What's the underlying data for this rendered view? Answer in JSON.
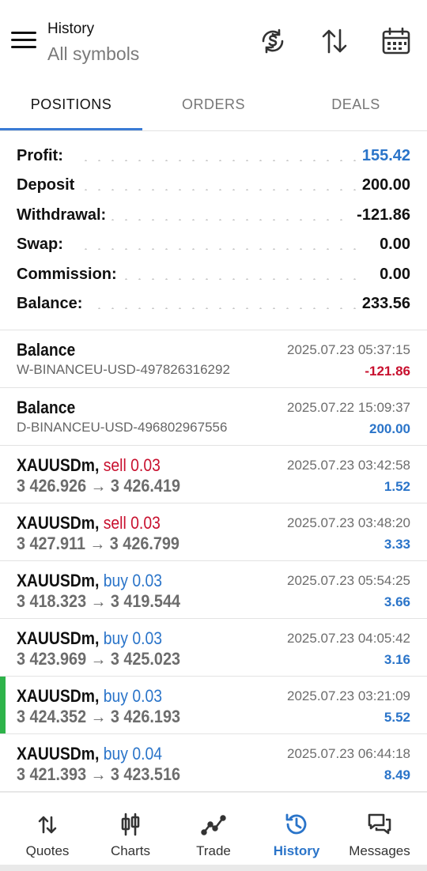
{
  "header": {
    "title": "History",
    "subtitle": "All symbols",
    "icons": [
      "menu-icon",
      "currency-exchange-icon",
      "sort-icon",
      "calendar-icon"
    ]
  },
  "tabs": [
    {
      "label": "POSITIONS",
      "active": true
    },
    {
      "label": "ORDERS",
      "active": false
    },
    {
      "label": "DEALS",
      "active": false
    }
  ],
  "summary": [
    {
      "label": "Profit:",
      "value": "155.42",
      "color": "#2a74c9"
    },
    {
      "label": "Deposit",
      "value": "200.00",
      "color": "#111111"
    },
    {
      "label": "Withdrawal:",
      "value": "-121.86",
      "color": "#111111"
    },
    {
      "label": "Swap:",
      "value": "0.00",
      "color": "#111111"
    },
    {
      "label": "Commission:",
      "value": "0.00",
      "color": "#111111"
    },
    {
      "label": "Balance:",
      "value": "233.56",
      "color": "#111111"
    }
  ],
  "deals": [
    {
      "type": "balance",
      "title": "Balance",
      "detail": "W-BINANCEU-USD-497826316292",
      "time": "2025.07.23 05:37:15",
      "amount": "-121.86",
      "amount_color": "#c8102e"
    },
    {
      "type": "balance",
      "title": "Balance",
      "detail": "D-BINANCEU-USD-496802967556",
      "time": "2025.07.22 15:09:37",
      "amount": "200.00",
      "amount_color": "#2a74c9"
    },
    {
      "type": "trade",
      "symbol": "XAUUSDm,",
      "action": "sell 0.03",
      "action_color": "#c8102e",
      "prices": "3 426.926 → 3 426.419",
      "time": "2025.07.23 03:42:58",
      "amount": "1.52",
      "amount_color": "#2a74c9"
    },
    {
      "type": "trade",
      "symbol": "XAUUSDm,",
      "action": "sell 0.03",
      "action_color": "#c8102e",
      "prices": "3 427.911 → 3 426.799",
      "time": "2025.07.23 03:48:20",
      "amount": "3.33",
      "amount_color": "#2a74c9"
    },
    {
      "type": "trade",
      "symbol": "XAUUSDm,",
      "action": "buy 0.03",
      "action_color": "#2a74c9",
      "prices": "3 418.323 → 3 419.544",
      "time": "2025.07.23 05:54:25",
      "amount": "3.66",
      "amount_color": "#2a74c9"
    },
    {
      "type": "trade",
      "symbol": "XAUUSDm,",
      "action": "buy 0.03",
      "action_color": "#2a74c9",
      "prices": "3 423.969 → 3 425.023",
      "time": "2025.07.23 04:05:42",
      "amount": "3.16",
      "amount_color": "#2a74c9"
    },
    {
      "type": "trade",
      "symbol": "XAUUSDm,",
      "action": "buy 0.03",
      "action_color": "#2a74c9",
      "prices": "3 424.352 → 3 426.193",
      "time": "2025.07.23 03:21:09",
      "amount": "5.52",
      "amount_color": "#2a74c9",
      "marker_color": "#2eb34a"
    },
    {
      "type": "trade",
      "symbol": "XAUUSDm,",
      "action": "buy 0.04",
      "action_color": "#2a74c9",
      "prices": "3 421.393 → 3 423.516",
      "time": "2025.07.23 06:44:18",
      "amount": "8.49",
      "amount_color": "#2a74c9"
    }
  ],
  "nav": [
    {
      "label": "Quotes",
      "icon": "quotes-icon",
      "active": false
    },
    {
      "label": "Charts",
      "icon": "charts-icon",
      "active": false
    },
    {
      "label": "Trade",
      "icon": "trade-icon",
      "active": false
    },
    {
      "label": "History",
      "icon": "history-icon",
      "active": true
    },
    {
      "label": "Messages",
      "icon": "messages-icon",
      "active": false
    }
  ],
  "colors": {
    "accent": "#2a74c9",
    "loss": "#c8102e",
    "marker": "#2eb34a"
  }
}
